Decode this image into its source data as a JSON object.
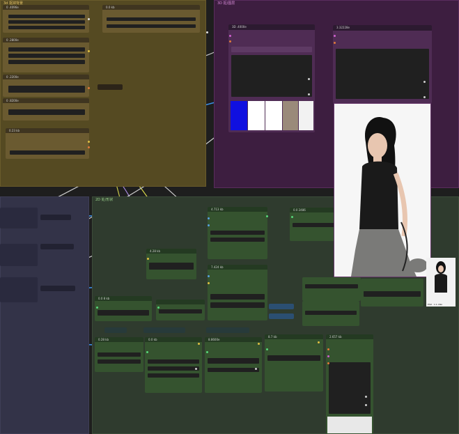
{
  "colors": {
    "group_yellow": "#554a22",
    "group_purple": "#3d1e40",
    "group_green": "#2f3b2e",
    "group_blue": "#333348",
    "node_yellow": "#6a5a30",
    "node_purple": "#4f2c54",
    "node_green": "#35532f",
    "accent_wire_green": "#57d67a",
    "accent_wire_blue": "#3a8ee6",
    "accent_wire_purple": "#b08ae8"
  },
  "groups": {
    "yellow_title": "3d 抠掉背景",
    "purple_title": "3D 抠/图层",
    "green_title": "2D 处/形状"
  },
  "nodes": {
    "y1": "0 .4096e",
    "y2": "0.0 kb",
    "y3": "0 .2800e",
    "y4": "0 .2200e",
    "y5": "0 .8200e",
    "y6": "0.23 kb",
    "p1": "3D .4000e",
    "p2": "3.32228e",
    "g1": "4.713 kb",
    "g2": "0.0 2486",
    "g3": "4.28 kb",
    "g4": "7.424 kb",
    "g5": "0.0 8 kb",
    "g6": "0.28 kb",
    "g7": "0.0 kb",
    "g8": "8.8600e",
    "g9": "8.7 kb",
    "g10": "2.657 kb"
  },
  "preview_caption": "PSD · 1:1 ANA",
  "icons": [
    "link-icon",
    "collapse-icon"
  ]
}
